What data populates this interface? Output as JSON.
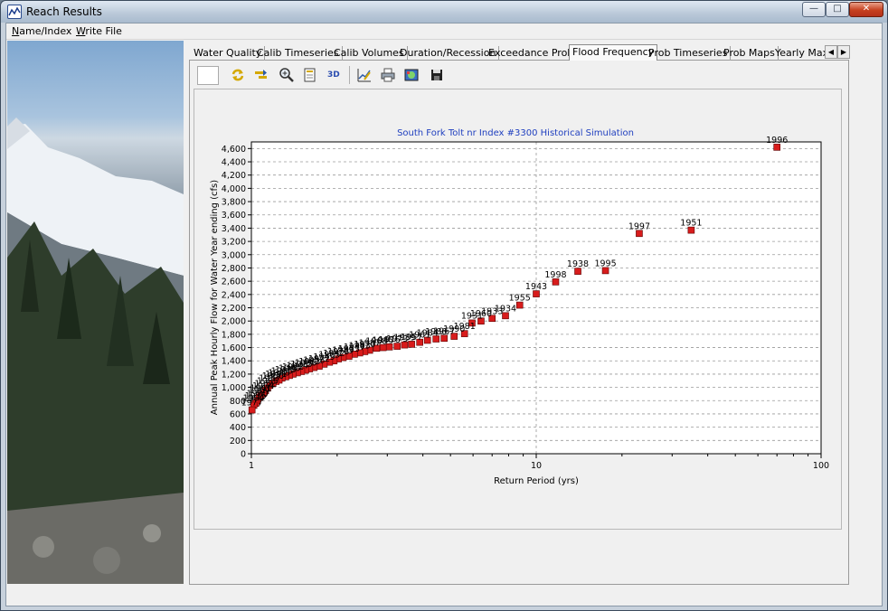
{
  "window": {
    "title": "Reach Results",
    "min_label": "—",
    "max_label": "□",
    "close_label": "✕"
  },
  "menu": [
    {
      "first": "N",
      "rest": "ame/Index"
    },
    {
      "first": "W",
      "rest": "rite File"
    }
  ],
  "tabs": [
    {
      "label": "Water Quality",
      "active": false
    },
    {
      "label": "Calib Timeseries",
      "active": false
    },
    {
      "label": "Calib Volumes",
      "active": false
    },
    {
      "label": "Duration/Recession",
      "active": false
    },
    {
      "label": "Exceedance Prob",
      "active": false
    },
    {
      "label": "Flood Frequency",
      "active": true
    },
    {
      "label": "Prob Timeseries",
      "active": false
    },
    {
      "label": "Prob Maps",
      "active": false
    },
    {
      "label": "Yearly Max/",
      "active": false
    }
  ],
  "tab_scroll": {
    "left": "◀",
    "right": "▶"
  },
  "toolbar": {
    "icons": [
      "refresh-icon",
      "step-icon",
      "zoom-icon",
      "page-icon",
      "3d-toggle",
      "chart-edit-icon",
      "print-icon",
      "copy-image-icon",
      "save-icon"
    ],
    "three_d_label": "3D"
  },
  "colors": {
    "accent_title": "#1f3fbf",
    "marker": "#d81c1c",
    "marker_edge": "#5a0000"
  },
  "chart_data": {
    "type": "scatter",
    "title": "South Fork Tolt nr Index #3300 Historical Simulation",
    "xlabel": "Return Period (yrs)",
    "ylabel": "Annual Peak Hourly Flow for Water Year ending (cfs)",
    "x_scale": "log",
    "xlim": [
      1,
      100
    ],
    "ylim": [
      0,
      4700
    ],
    "x_ticks": [
      "1",
      "10",
      "100"
    ],
    "y_ticks": [
      "0",
      "200",
      "400",
      "600",
      "800",
      "1,000",
      "1,200",
      "1,400",
      "1,600",
      "1,800",
      "2,000",
      "2,200",
      "2,400",
      "2,600",
      "2,800",
      "3,000",
      "3,200",
      "3,400",
      "3,600",
      "3,800",
      "4,000",
      "4,200",
      "4,400",
      "4,600"
    ],
    "grid": true,
    "marker": "square",
    "labeled_points": [
      {
        "label": "1996",
        "x": 70,
        "y": 4620
      },
      {
        "label": "1951",
        "x": 35,
        "y": 3370
      },
      {
        "label": "1997",
        "x": 23,
        "y": 3320
      },
      {
        "label": "1995",
        "x": 17.5,
        "y": 2760
      },
      {
        "label": "1938",
        "x": 14,
        "y": 2750
      },
      {
        "label": "1998",
        "x": 11.7,
        "y": 2590
      },
      {
        "label": "1943",
        "x": 10,
        "y": 2410
      },
      {
        "label": "1955",
        "x": 8.75,
        "y": 2240
      },
      {
        "label": "1934",
        "x": 7.8,
        "y": 2080
      },
      {
        "label": "1933",
        "x": 7.0,
        "y": 2040
      },
      {
        "label": "1960",
        "x": 6.4,
        "y": 2000
      },
      {
        "label": "1931",
        "x": 5.95,
        "y": 1970
      },
      {
        "label": "1981",
        "x": 5.6,
        "y": 1810
      },
      {
        "label": "1990",
        "x": 5.15,
        "y": 1770
      },
      {
        "label": "1967",
        "x": 4.75,
        "y": 1740
      },
      {
        "label": "1986",
        "x": 4.45,
        "y": 1730
      },
      {
        "label": "1984",
        "x": 4.15,
        "y": 1710
      },
      {
        "label": "1961",
        "x": 3.9,
        "y": 1680
      },
      {
        "label": "1957",
        "x": 3.65,
        "y": 1650
      },
      {
        "label": "1939",
        "x": 3.45,
        "y": 1640
      },
      {
        "label": "1973",
        "x": 3.25,
        "y": 1620
      },
      {
        "label": "1976",
        "x": 3.05,
        "y": 1610
      },
      {
        "label": "1945",
        "x": 2.9,
        "y": 1600
      },
      {
        "label": "1968",
        "x": 2.75,
        "y": 1590
      },
      {
        "label": "1987",
        "x": 2.6,
        "y": 1560
      },
      {
        "label": "1970",
        "x": 2.5,
        "y": 1540
      },
      {
        "label": "1963",
        "x": 2.4,
        "y": 1520
      },
      {
        "label": "1947",
        "x": 2.3,
        "y": 1500
      },
      {
        "label": "1953",
        "x": 2.2,
        "y": 1470
      },
      {
        "label": "1989",
        "x": 2.1,
        "y": 1450
      },
      {
        "label": "1978",
        "x": 2.02,
        "y": 1430
      },
      {
        "label": "1942",
        "x": 1.95,
        "y": 1400
      },
      {
        "label": "1965",
        "x": 1.88,
        "y": 1380
      },
      {
        "label": "1949",
        "x": 1.8,
        "y": 1350
      },
      {
        "label": "1972",
        "x": 1.73,
        "y": 1320
      },
      {
        "label": "1958",
        "x": 1.66,
        "y": 1300
      },
      {
        "label": "1983",
        "x": 1.6,
        "y": 1280
      },
      {
        "label": "1936",
        "x": 1.55,
        "y": 1260
      },
      {
        "label": "1975",
        "x": 1.5,
        "y": 1240
      },
      {
        "label": "1944",
        "x": 1.45,
        "y": 1220
      },
      {
        "label": "1962",
        "x": 1.4,
        "y": 1200
      },
      {
        "label": "1940",
        "x": 1.36,
        "y": 1180
      },
      {
        "label": "1979",
        "x": 1.32,
        "y": 1160
      },
      {
        "label": "1956",
        "x": 1.28,
        "y": 1140
      },
      {
        "label": "1948",
        "x": 1.25,
        "y": 1110
      },
      {
        "label": "1991",
        "x": 1.22,
        "y": 1090
      },
      {
        "label": "1966",
        "x": 1.19,
        "y": 1060
      },
      {
        "label": "1937",
        "x": 1.16,
        "y": 1030
      },
      {
        "label": "1985",
        "x": 1.14,
        "y": 990
      },
      {
        "label": "1952",
        "x": 1.12,
        "y": 950
      },
      {
        "label": "1974",
        "x": 1.1,
        "y": 910
      },
      {
        "label": "1941",
        "x": 1.08,
        "y": 880
      },
      {
        "label": "1964",
        "x": 1.065,
        "y": 850
      },
      {
        "label": "1980",
        "x": 1.05,
        "y": 800
      },
      {
        "label": "1935",
        "x": 1.035,
        "y": 760
      },
      {
        "label": "1994",
        "x": 1.02,
        "y": 730
      },
      {
        "label": "1977",
        "x": 1.005,
        "y": 660
      }
    ]
  }
}
